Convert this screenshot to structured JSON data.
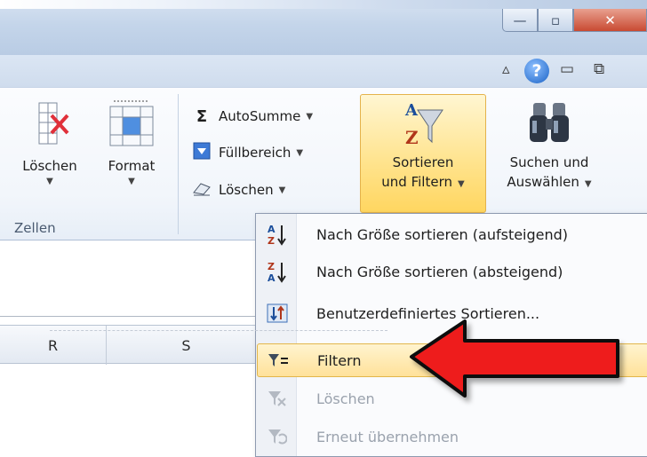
{
  "window_controls": {
    "minimize": "—",
    "maximize": "▫",
    "close": "✕"
  },
  "help_bar": {
    "collapse_icon": "▵",
    "help_icon": "?",
    "minimize_ribbon": "▭",
    "restore_icon": "⧉"
  },
  "ribbon": {
    "zellen_group": {
      "label": "Zellen",
      "loeschen": {
        "label": "Löschen",
        "icon": "delete-cells-icon"
      },
      "format": {
        "label": "Format",
        "icon": "format-cells-icon"
      }
    },
    "bearbeiten_group": {
      "autosumme": {
        "label": "AutoSumme",
        "icon": "Σ"
      },
      "fuellbereich": {
        "label": "Füllbereich",
        "icon": "fill-down-icon"
      },
      "loeschen": {
        "label": "Löschen",
        "icon": "eraser-icon"
      },
      "sortieren": {
        "line1": "Sortieren",
        "line2": "und Filtern",
        "icon": "sort-filter-icon"
      },
      "suchen": {
        "line1": "Suchen und",
        "line2": "Auswählen",
        "icon": "binoculars-icon"
      }
    }
  },
  "columns": [
    "R",
    "S"
  ],
  "sort_menu": {
    "items": [
      {
        "label": "Nach Größe sortieren (aufsteigend)",
        "icon": "sort-ascending-icon",
        "enabled": true
      },
      {
        "label": "Nach Größe sortieren (absteigend)",
        "icon": "sort-descending-icon",
        "enabled": true
      },
      {
        "label": "Benutzerdefiniertes Sortieren...",
        "icon": "custom-sort-icon",
        "enabled": true
      },
      {
        "label": "Filtern",
        "icon": "filter-icon",
        "enabled": true,
        "highlighted": true
      },
      {
        "label": "Löschen",
        "icon": "clear-filter-icon",
        "enabled": false
      },
      {
        "label": "Erneut übernehmen",
        "icon": "reapply-filter-icon",
        "enabled": false
      }
    ]
  },
  "colors": {
    "highlight": "#ffe19a",
    "arrow": "#e8191b",
    "ribbon": "#f2f6fb"
  }
}
